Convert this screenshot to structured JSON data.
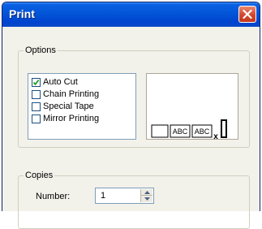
{
  "window": {
    "title": "Print"
  },
  "options": {
    "legend": "Options",
    "checkboxes": [
      {
        "label": "Auto Cut",
        "checked": true
      },
      {
        "label": "Chain Printing",
        "checked": false
      },
      {
        "label": "Special Tape",
        "checked": false
      },
      {
        "label": "Mirror Printing",
        "checked": false
      }
    ],
    "preview": {
      "segments": [
        "ABC",
        "ABC"
      ],
      "cut_mark": "x"
    }
  },
  "copies": {
    "legend": "Copies",
    "number_label": "Number:",
    "number_value": "1"
  },
  "colors": {
    "titlebar": "#0355d8",
    "close_button": "#d3462c",
    "dialog_bg": "#f2f1ea"
  }
}
